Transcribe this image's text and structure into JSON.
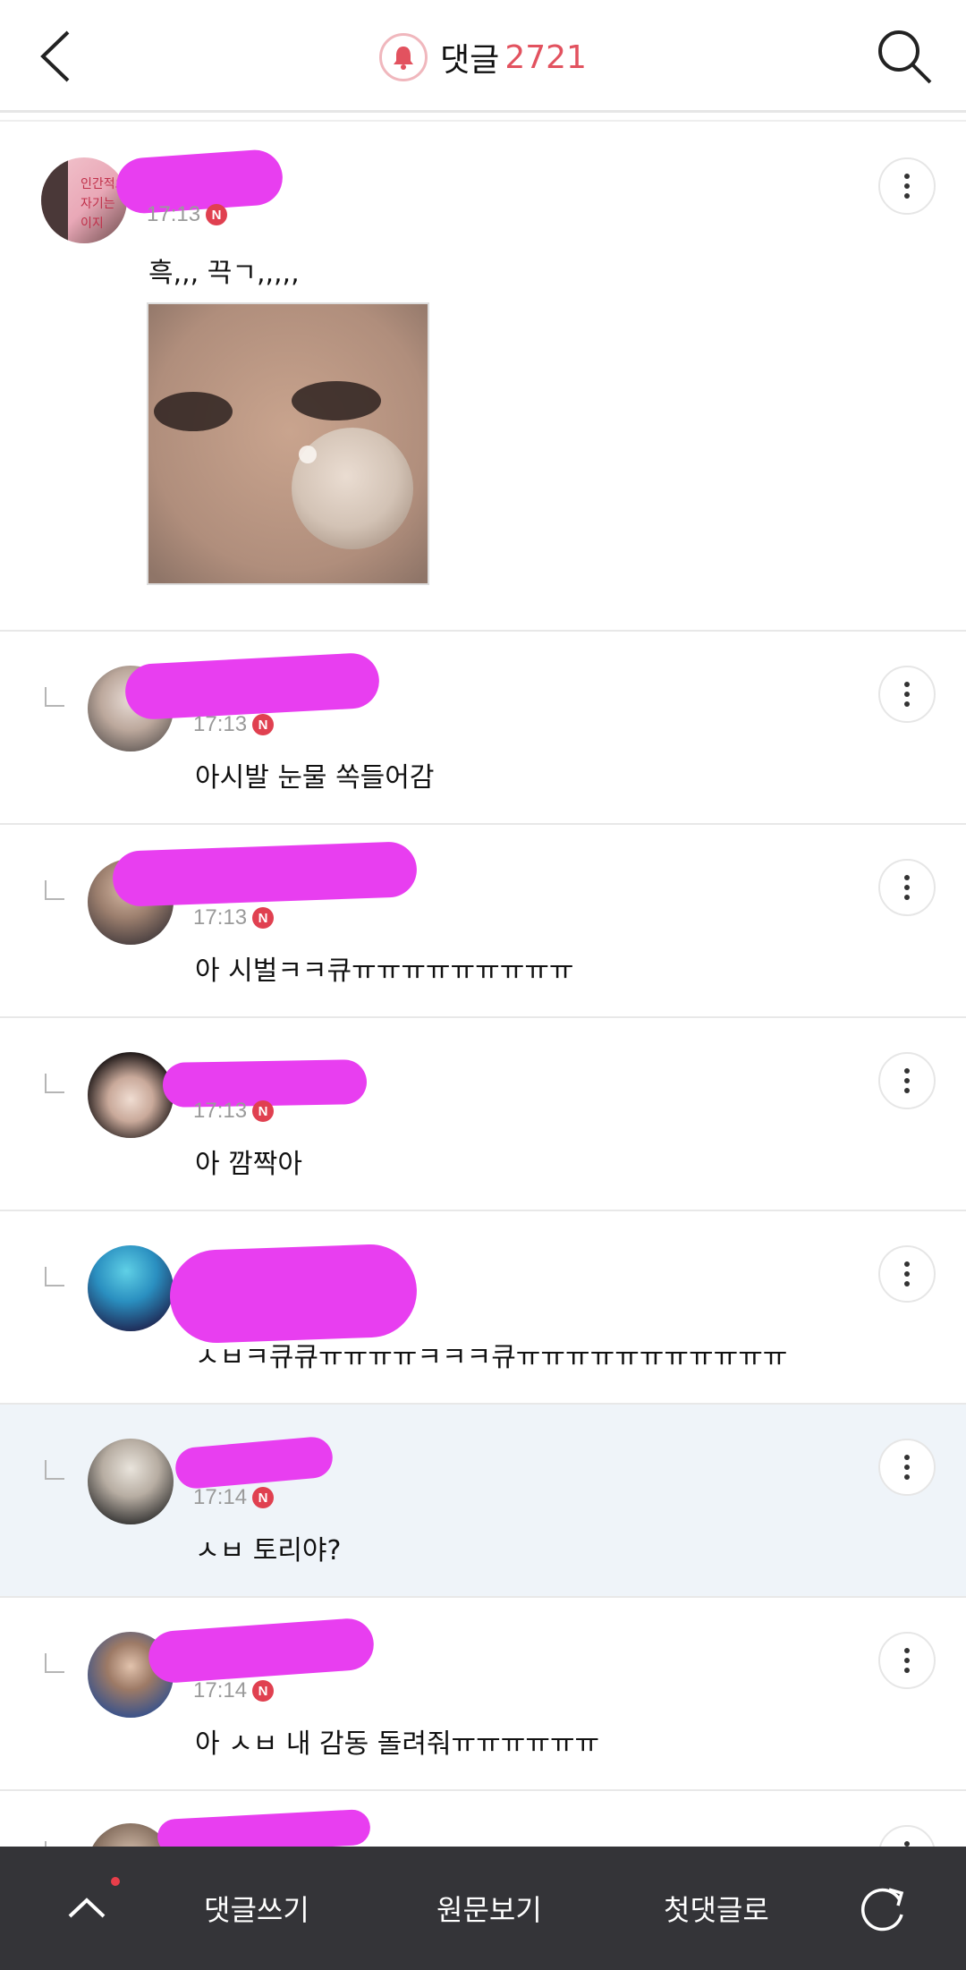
{
  "header": {
    "title": "댓글",
    "count": "2721"
  },
  "comments": [
    {
      "time": "17:13",
      "text": "흑,,, 끅ㄱ,,,,,"
    },
    {
      "time": "17:13",
      "text": "아시발 눈물 쏙들어감"
    },
    {
      "time": "17:13",
      "text": "아 시벌ㅋㅋ큐ㅠㅠㅠㅠㅠㅠㅠㅠㅠ"
    },
    {
      "time": "17:13",
      "text": "아 깜짝아"
    },
    {
      "time": "",
      "text": "ㅅㅂㅋ큐큐ㅠㅠㅠㅠㅋㅋㅋ큐ㅠㅠㅠㅠㅠㅠㅠㅠㅠㅠㅠ"
    },
    {
      "time": "17:14",
      "text": "ㅅㅂ 토리야?"
    },
    {
      "time": "17:14",
      "text": "아 ㅅㅂ 내 감동 돌려줘ㅠㅠㅠㅠㅠㅠ"
    }
  ],
  "badge": "N",
  "bottom_bar": {
    "write": "댓글쓰기",
    "view_original": "원문보기",
    "first_comment": "첫댓글로"
  },
  "colors": {
    "accent": "#e2525f",
    "redaction": "#e83ef0",
    "bottom_bar": "#343438",
    "highlight_row": "#eff4f9"
  }
}
